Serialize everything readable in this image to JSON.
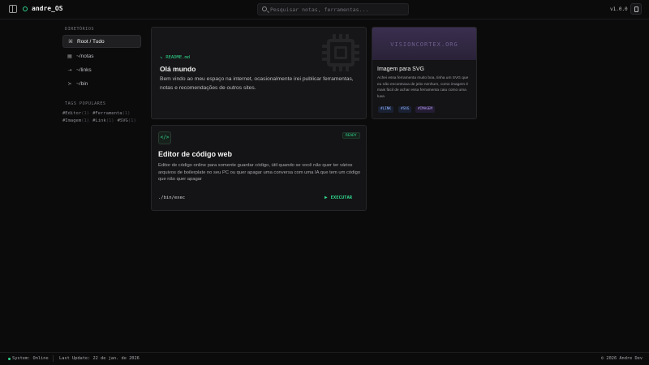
{
  "header": {
    "app_name": "andre_OS",
    "search_placeholder": "Pesquisar notas, ferramentas...",
    "version": "v1.0.0",
    "icons": {
      "toggle": "sidebar-toggle-icon",
      "theme": "document-icon",
      "logo": "status-ring-icon",
      "search": "search-icon"
    }
  },
  "sidebar": {
    "directories_title": "DIRETÓRIOS",
    "directories": [
      {
        "label": "Root / Tudo",
        "icon": "⌘",
        "active": true
      },
      {
        "label": "~/notas",
        "icon": "▤",
        "active": false
      },
      {
        "label": "~/links",
        "icon": "⇢",
        "active": false
      },
      {
        "label": "~/bin",
        "icon": "≻",
        "active": false
      }
    ],
    "tags_title": "TAGS POPULARES",
    "tags": [
      {
        "name": "#Editor",
        "count": "(1)"
      },
      {
        "name": "#Ferramenta",
        "count": "(1)"
      },
      {
        "name": "#Imagem",
        "count": "(1)"
      },
      {
        "name": "#Link",
        "count": "(1)"
      },
      {
        "name": "#SVG",
        "count": "(1)"
      }
    ]
  },
  "cards": {
    "readme": {
      "tag": "README.md",
      "tag_arrow": "↘",
      "title": "Olá mundo",
      "body": "Bem vindo ao meu espaço na internet, ocasionalmente irei publicar ferramentas, notas e recomendações de outros sites."
    },
    "svg": {
      "banner": "VISIONCORTEX.ORG",
      "title": "Imagem para SVG",
      "body": "Achei essa ferramenta muito boa, tinha um SVG que eu não encontrava de jeito nenhum, como imagem é mais fácil de achar essa ferramenta caiu como uma luva",
      "tags": [
        "#LINK",
        "#SVG",
        "#IMAGEM"
      ]
    },
    "editor": {
      "icon": "</>",
      "badge": "READY",
      "title": "Editor de código web",
      "body": "Editor de código online para somente guardar código, útil quando se você não quer ter vários arquivos de boilerplate no seu PC ou quer apagar uma conversa com uma IA que tem um código que não quer apagar",
      "command": "./bin/exec",
      "action": "EXECUTAR",
      "action_icon": "▶"
    }
  },
  "footer": {
    "status": "System: Online",
    "last_update": "Last Update: 22 de jan. de 2026",
    "copyright": "© 2026 Andre Dev"
  },
  "colors": {
    "accent": "#2fd38a",
    "background": "#0b0b0c",
    "card": "#141416",
    "tag_purple": "#8b7bd8"
  }
}
